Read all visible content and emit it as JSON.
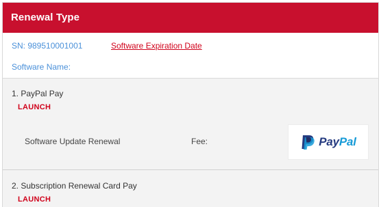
{
  "header": {
    "title": "Renewal Type"
  },
  "info": {
    "serial_number": "SN: 989510001001",
    "expiration_link": "Software Expiration Date",
    "software_name": "Software Name:"
  },
  "options": [
    {
      "title": "1. PayPal Pay",
      "brand": "LAUNCH",
      "item_label": "Software Update Renewal",
      "fee_label": "Fee:",
      "pay_button": {
        "word_dark": "Pay",
        "word_light": "Pal",
        "icon": "paypal-logo"
      }
    },
    {
      "title": "2. Subscription Renewal Card Pay",
      "brand": "LAUNCH"
    }
  ],
  "colors": {
    "header": "#c8102e",
    "link_blue": "#4a90d9",
    "link_red": "#d0021b",
    "paypal_dark": "#253b80",
    "paypal_light": "#179bd7"
  }
}
